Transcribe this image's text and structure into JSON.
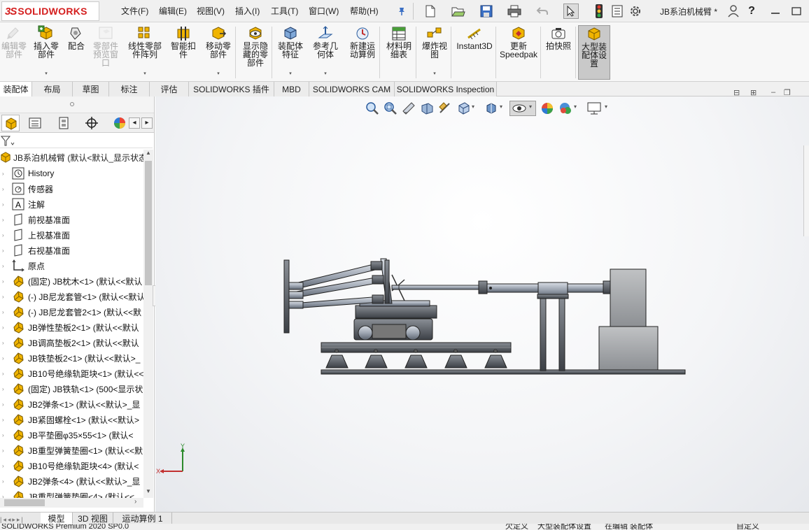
{
  "titlebar": {
    "logo_ds": "3S",
    "logo_text": "SOLIDWORKS",
    "menus": [
      "文件(F)",
      "编辑(E)",
      "视图(V)",
      "插入(I)",
      "工具(T)",
      "窗口(W)",
      "帮助(H)"
    ],
    "document_title": "JB系泊机械臂 *",
    "icons": [
      "pin-icon",
      "new-document-icon",
      "open-icon",
      "save-icon",
      "print-icon",
      "undo-icon",
      "select-icon",
      "traffic-light-icon",
      "file-properties-icon",
      "gear-icon",
      "user-icon",
      "help-icon",
      "minimize-icon",
      "maximize-icon"
    ]
  },
  "ribbon": {
    "buttons": [
      {
        "label": "编辑零\n部件",
        "icon": "edit-component-icon",
        "disabled": true
      },
      {
        "label": "插入零\n部件",
        "icon": "insert-component-icon",
        "disabled": false,
        "dropdown": true
      },
      {
        "label": "配合",
        "icon": "mate-icon",
        "disabled": false
      },
      {
        "label": "零部件\n预览窗\n口",
        "icon": "component-preview-icon",
        "disabled": true
      },
      {
        "label": "线性零部\n件阵列",
        "icon": "linear-pattern-icon",
        "disabled": false,
        "dropdown": true
      },
      {
        "label": "智能扣\n件",
        "icon": "smart-fasteners-icon",
        "disabled": false
      },
      {
        "label": "移动零\n部件",
        "icon": "move-component-icon",
        "disabled": false,
        "dropdown": true
      },
      {
        "label": "显示隐\n藏的零\n部件",
        "icon": "show-hidden-icon",
        "disabled": false
      },
      {
        "label": "装配体\n特征",
        "icon": "assembly-features-icon",
        "disabled": false,
        "dropdown": true
      },
      {
        "label": "参考几\n何体",
        "icon": "reference-geometry-icon",
        "disabled": false,
        "dropdown": true
      },
      {
        "label": "新建运\n动算例",
        "icon": "new-motion-study-icon",
        "disabled": false
      },
      {
        "label": "材料明\n细表",
        "icon": "bom-icon",
        "disabled": false
      },
      {
        "label": "爆炸视\n图",
        "icon": "exploded-view-icon",
        "disabled": false,
        "dropdown": true
      },
      {
        "label": "Instant3D",
        "icon": "instant3d-icon",
        "disabled": false
      },
      {
        "label": "更新\nSpeedpak",
        "icon": "speedpak-icon",
        "disabled": false
      },
      {
        "label": "拍快照",
        "icon": "snapshot-icon",
        "disabled": false
      },
      {
        "label": "大型装\n配体设\n置",
        "icon": "large-assembly-icon",
        "disabled": false,
        "active": true
      }
    ]
  },
  "command_tabs": [
    "装配体",
    "布局",
    "草图",
    "标注",
    "评估",
    "SOLIDWORKS 插件",
    "MBD",
    "SOLIDWORKS CAM",
    "SOLIDWORKS Inspection"
  ],
  "feature_manager": {
    "root": "JB系泊机械臂 (默认<默认_显示状态",
    "items": [
      {
        "label": "History",
        "icon": "history-icon"
      },
      {
        "label": "传感器",
        "icon": "sensor-icon"
      },
      {
        "label": "注解",
        "icon": "annotation-icon"
      },
      {
        "label": "前视基准面",
        "icon": "plane-icon"
      },
      {
        "label": "上视基准面",
        "icon": "plane-icon"
      },
      {
        "label": "右视基准面",
        "icon": "plane-icon"
      },
      {
        "label": "原点",
        "icon": "origin-icon"
      },
      {
        "label": "(固定) JB枕木<1> (默认<<默认",
        "icon": "part-icon"
      },
      {
        "label": "(-) JB尼龙套管<1> (默认<<默认",
        "icon": "part-icon"
      },
      {
        "label": "(-) JB尼龙套管2<1> (默认<<默",
        "icon": "part-icon"
      },
      {
        "label": "JB弹性垫板2<1> (默认<<默认",
        "icon": "part-icon"
      },
      {
        "label": "JB调高垫板2<1> (默认<<默认",
        "icon": "part-icon"
      },
      {
        "label": "JB铁垫板2<1> (默认<<默认>_",
        "icon": "part-icon"
      },
      {
        "label": "JB10号绝缘轨距块<1> (默认<<",
        "icon": "part-icon"
      },
      {
        "label": "(固定) JB铁轨<1> (500<显示状",
        "icon": "part-icon"
      },
      {
        "label": "JB2弹条<1> (默认<<默认>_显",
        "icon": "part-icon"
      },
      {
        "label": "JB紧固螺栓<1> (默认<<默认>",
        "icon": "part-icon"
      },
      {
        "label": "JB平垫圈φ35×55<1> (默认<",
        "icon": "part-icon"
      },
      {
        "label": "JB重型弹簧垫圈<1> (默认<<默",
        "icon": "part-icon"
      },
      {
        "label": "JB10号绝缘轨距块<4> (默认<",
        "icon": "part-icon"
      },
      {
        "label": "JB2弹条<4> (默认<<默认>_显",
        "icon": "part-icon"
      },
      {
        "label": "JB重型弹簧垫圈<4> (默认<<",
        "icon": "part-icon"
      }
    ]
  },
  "viewport": {
    "triad": {
      "x": "X",
      "y": "Y"
    }
  },
  "bottom_tabs": [
    "模型",
    "3D 视图",
    "运动算例 1"
  ],
  "status": {
    "left": "SOLIDWORKS Premium 2020 SP0.0",
    "items": [
      "欠定义",
      "大型装配体设置",
      "在编辑 装配体",
      "自定义"
    ]
  },
  "colors": {
    "accent": "#d41e1e",
    "part_icon": "#f0b400",
    "ribbon_bg": "#f7f7f7"
  }
}
